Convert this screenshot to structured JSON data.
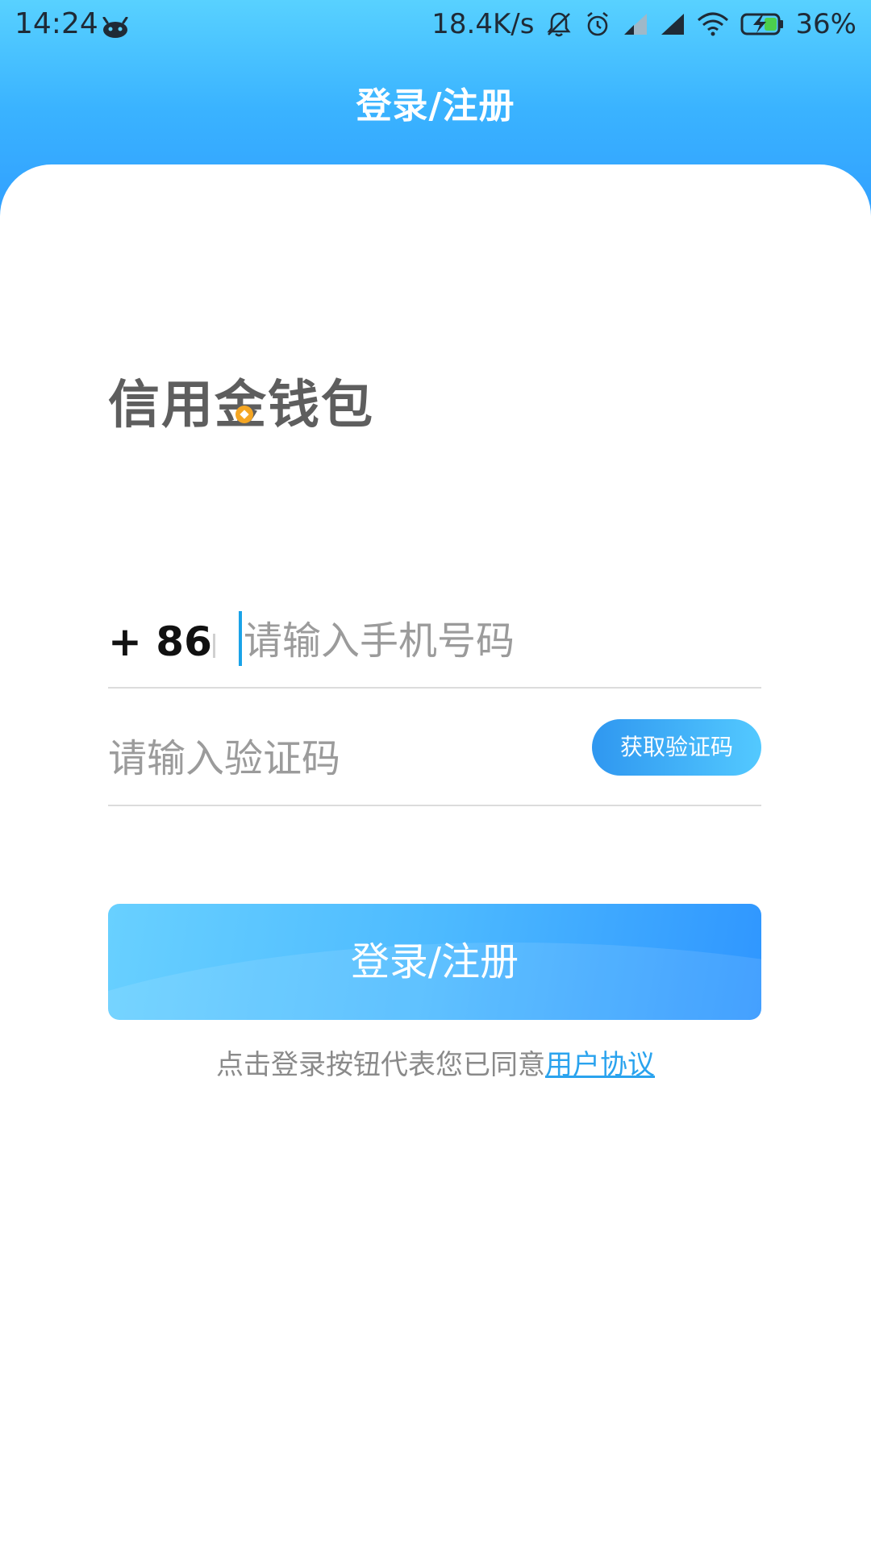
{
  "status_bar": {
    "time": "14:24",
    "network_speed": "18.4K/s",
    "battery_percent": "36%"
  },
  "header": {
    "title": "登录/注册"
  },
  "logo": {
    "text_part1": "信用金",
    "text_part2": "钱包"
  },
  "form": {
    "country_code": "+ 86",
    "phone_placeholder": "请输入手机号码",
    "code_placeholder": "请输入验证码",
    "get_code_label": "获取验证码"
  },
  "login_button": {
    "label": "登录/注册"
  },
  "agreement": {
    "text": "点击登录按钮代表您已同意",
    "link_text": "用户协议"
  },
  "colors": {
    "header_gradient_top": "#58d1ff",
    "header_gradient_bottom": "#2f9bff",
    "accent": "#2aa3ee",
    "logo_coin": "#f5a623"
  },
  "icons": {
    "status": [
      "android-robot-icon",
      "mute-bell-icon",
      "alarm-icon",
      "signal-icon",
      "signal-icon",
      "wifi-icon",
      "battery-charging-icon"
    ],
    "logo_coin": "coin-icon"
  }
}
